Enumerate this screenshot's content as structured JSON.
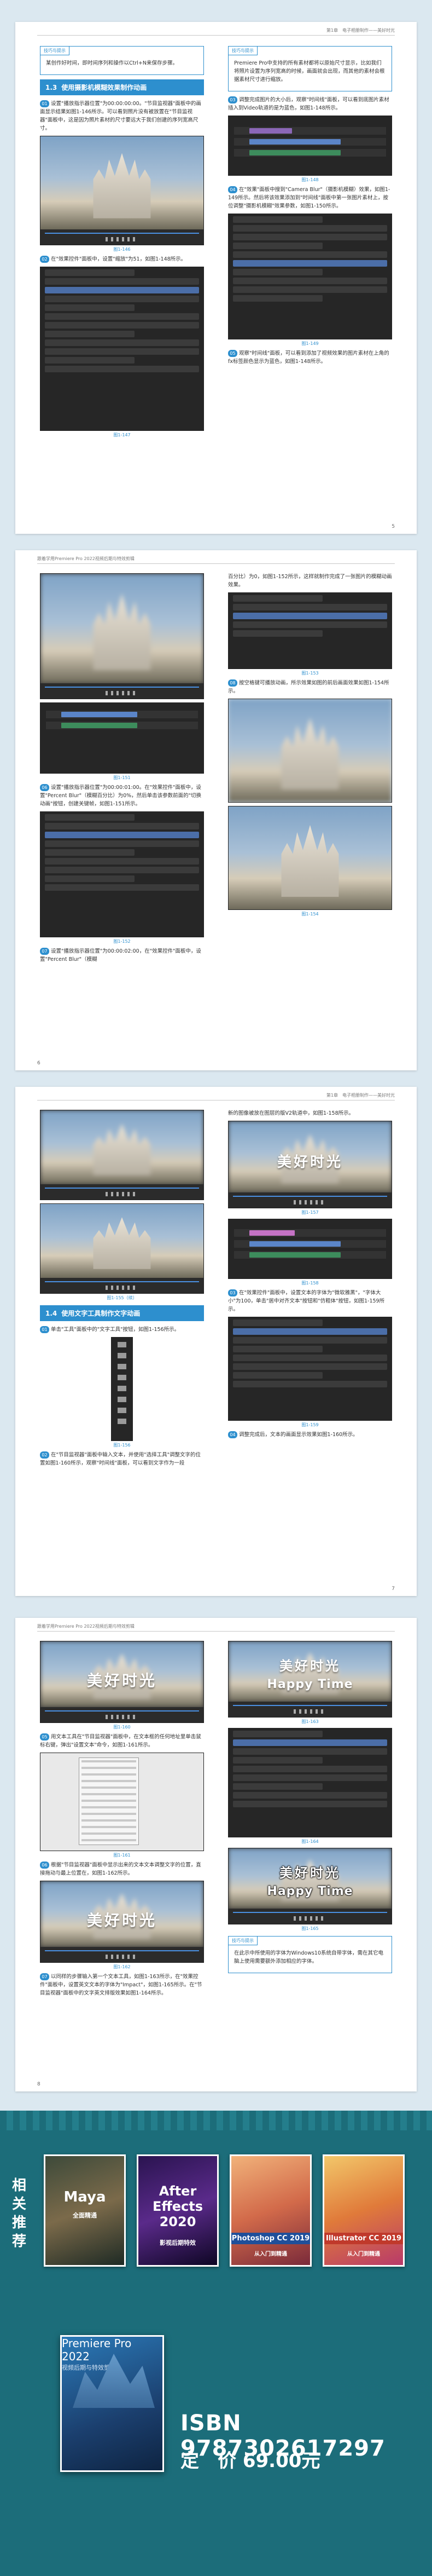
{
  "pages": [
    {
      "runhead": "第1章　电子相册制作——美好时光",
      "page_number": "5",
      "tip1": {
        "header": "技巧与提示",
        "text": "某创作好时间，即时间序列和操作以Ctrl+N来保存步骤。"
      },
      "section": {
        "num": "1.3",
        "title": "使用摄影机模糊效果制作动画"
      },
      "steps_left": [
        {
          "n": "01",
          "text": "设置\"播放指示器位置\"为00:00:00:00。\"节目监视器\"面板中的画面显示结果如图1-146所示。可以看到照片没有被放置在\"节目监视器\"面板中，这是因为照片素材的尺寸要远大于我们创建的序列宽高尺寸。"
        },
        {
          "n": "02",
          "text": "在\"效果控件\"面板中，设置\"缩放\"为51，如图1-148所示。"
        }
      ],
      "figs_left": [
        "图1-146",
        "图1-147"
      ],
      "tip2": {
        "header": "技巧与提示",
        "text": "Premiere Pro中支持的所有素材都将以原始尺寸显示，比如我们将照片设置为序列宽高的时候，画面就会出现，而其他的素材会根据素材尺寸进行缩放。"
      },
      "steps_right": [
        {
          "n": "03",
          "text": "调整完成图片的大小后，观察\"时间线\"面板，可以看到底图片素材插入到Video轨道的是为蓝色，如图1-148所示。"
        },
        {
          "n": "04",
          "text": "在\"效果\"面板中搜到\"Camera Blur\"（摄影机模糊）效果，如图1-149所示。然后将该效果添加到\"时间线\"面板中第一张图片素材上，按位调整\"摄影机模糊\"效果参数，如图1-150所示。"
        },
        {
          "n": "05",
          "text": "观察\"时间线\"面板，可以看到添加了视频效果的图片素材在上角的fx标签颜色显示为蓝色，如图1-148所示。"
        }
      ],
      "figs_right": [
        "图1-148",
        "图1-149",
        "图1-150"
      ]
    },
    {
      "runhead": "跟着学用Premiere Pro 2022视频后期与特效剪辑",
      "page_number": "6",
      "steps_left": [
        {
          "n": "06",
          "text": "设置\"播放指示器位置\"为00:00:01:00。在\"效果控件\"面板中，设置\"Percent Blur\"（模糊百分比）为0%，然后单击该参数前面的\"切换动画\"按钮，创建关键帧，如图1-151所示。"
        },
        {
          "n": "07",
          "text": "设置\"播放指示器位置\"为00:00:02:00，在\"效果控件\"面板中，设置\"Percent Blur\"（模糊"
        }
      ],
      "figs_left": [
        "图1-151",
        "图1-152"
      ],
      "text_right": "百分比）为0，如图1-152所示，这样就制作完成了一张图片的模糊动画效果。",
      "figs_right": [
        "图1-153",
        "图1-154"
      ],
      "steps_right": [
        {
          "n": "08",
          "text": "按空格键可播放动画，所示效果如图的前后画面效果如图1-154所示。"
        }
      ]
    },
    {
      "runhead": "第1章　电子相册制作——美好时光",
      "page_number": "7",
      "figs_left": [
        "图1-155（续）"
      ],
      "section": {
        "num": "1.4",
        "title": "使用文字工具制作文字动画"
      },
      "steps_left": [
        {
          "n": "01",
          "text": "单击\"工具\"面板中的\"文字工具\"按钮，如图1-156所示。"
        },
        {
          "n": "02",
          "text": "在\"节目监视器\"面板中输入文本，并使用\"选择工具\"调整文字的位置如图1-160所示，观察\"时间线\"面板，可以看到文字作为一段"
        }
      ],
      "figs_left2": [
        "图1-156"
      ],
      "text_right": "新的图像被放在图层的版V2轨道中，如图1-158所示。",
      "overlay_text": "美好时光",
      "steps_right": [
        {
          "n": "03",
          "text": "在\"效果控件\"面板中，设置文本的字体为\"微软雅黑\"，\"字体大小\"为100，单击\"居中对齐文本\"按钮和\"仿粗体\"按钮，如图1-159所示。"
        },
        {
          "n": "04",
          "text": "调整完成后，文本的画面显示效果如图1-160所示。"
        }
      ],
      "figs_right": [
        "图1-157",
        "图1-158",
        "图1-159"
      ]
    },
    {
      "runhead": "跟着学用Premiere Pro 2022视频后期与特效剪辑",
      "page_number": "8",
      "overlay_text": "美好时光",
      "overlay_sub": "Happy Time",
      "steps_left": [
        {
          "n": "05",
          "text": "用文本工具在\"节目监视器\"面板中，在文本框的任何地址里单击鼠标右键，弹出\"设置文本\"命令，如图1-161所示。"
        },
        {
          "n": "06",
          "text": "根据\"节目监视器\"面板中显示出来的文本文本调整文字的位置，直接拖动与最上位置在，如图1-162所示。"
        },
        {
          "n": "07",
          "text": "以同样的步骤输入第一个文本工具，如图1-163所示，在\"效果控件\"面板中，设置英文文本的字体为\"Impact\"，如图1-165所示。在\"节目监视器\"面板中的文字英文排版效果如图1-164所示。"
        }
      ],
      "figs_left": [
        "图1-160",
        "图1-161",
        "图1-162"
      ],
      "figs_right": [
        "图1-163",
        "图1-164",
        "图1-165"
      ],
      "tip": {
        "header": "技巧与提示",
        "text": "在此示中所使用的字体为Windows10系统自带字体，需在其它电脑上使用需要额外添加相应的字体。"
      }
    }
  ],
  "promo": {
    "label": "相关推荐",
    "books": [
      {
        "title": "Maya",
        "subtitle": "全面精通"
      },
      {
        "title": "After Effects 2020",
        "subtitle": "影视后期特效"
      },
      {
        "title": "Photoshop CC 2019",
        "subtitle": "从入门到精通"
      },
      {
        "title": "Illustrator CC 2019",
        "subtitle": "从入门到精通"
      }
    ],
    "main_book": {
      "title": "Premiere Pro 2022",
      "subtitle": "视频后期与特效剪辑"
    },
    "isbn": "ISBN 9787302617297",
    "price": "定　价 69.00元"
  },
  "colors": {
    "accent": "#2d8fce",
    "promo_bg": "#1c6d7a"
  }
}
